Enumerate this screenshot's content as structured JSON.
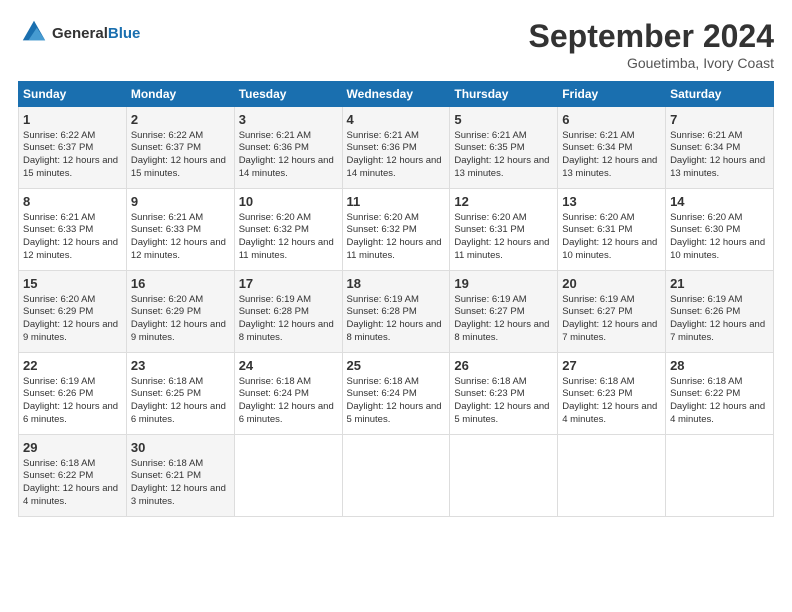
{
  "logo": {
    "text_general": "General",
    "text_blue": "Blue"
  },
  "header": {
    "month": "September 2024",
    "location": "Gouetimba, Ivory Coast"
  },
  "days_of_week": [
    "Sunday",
    "Monday",
    "Tuesday",
    "Wednesday",
    "Thursday",
    "Friday",
    "Saturday"
  ],
  "weeks": [
    [
      {
        "day": "1",
        "sunrise": "Sunrise: 6:22 AM",
        "sunset": "Sunset: 6:37 PM",
        "daylight": "Daylight: 12 hours and 15 minutes."
      },
      {
        "day": "2",
        "sunrise": "Sunrise: 6:22 AM",
        "sunset": "Sunset: 6:37 PM",
        "daylight": "Daylight: 12 hours and 15 minutes."
      },
      {
        "day": "3",
        "sunrise": "Sunrise: 6:21 AM",
        "sunset": "Sunset: 6:36 PM",
        "daylight": "Daylight: 12 hours and 14 minutes."
      },
      {
        "day": "4",
        "sunrise": "Sunrise: 6:21 AM",
        "sunset": "Sunset: 6:36 PM",
        "daylight": "Daylight: 12 hours and 14 minutes."
      },
      {
        "day": "5",
        "sunrise": "Sunrise: 6:21 AM",
        "sunset": "Sunset: 6:35 PM",
        "daylight": "Daylight: 12 hours and 13 minutes."
      },
      {
        "day": "6",
        "sunrise": "Sunrise: 6:21 AM",
        "sunset": "Sunset: 6:34 PM",
        "daylight": "Daylight: 12 hours and 13 minutes."
      },
      {
        "day": "7",
        "sunrise": "Sunrise: 6:21 AM",
        "sunset": "Sunset: 6:34 PM",
        "daylight": "Daylight: 12 hours and 13 minutes."
      }
    ],
    [
      {
        "day": "8",
        "sunrise": "Sunrise: 6:21 AM",
        "sunset": "Sunset: 6:33 PM",
        "daylight": "Daylight: 12 hours and 12 minutes."
      },
      {
        "day": "9",
        "sunrise": "Sunrise: 6:21 AM",
        "sunset": "Sunset: 6:33 PM",
        "daylight": "Daylight: 12 hours and 12 minutes."
      },
      {
        "day": "10",
        "sunrise": "Sunrise: 6:20 AM",
        "sunset": "Sunset: 6:32 PM",
        "daylight": "Daylight: 12 hours and 11 minutes."
      },
      {
        "day": "11",
        "sunrise": "Sunrise: 6:20 AM",
        "sunset": "Sunset: 6:32 PM",
        "daylight": "Daylight: 12 hours and 11 minutes."
      },
      {
        "day": "12",
        "sunrise": "Sunrise: 6:20 AM",
        "sunset": "Sunset: 6:31 PM",
        "daylight": "Daylight: 12 hours and 11 minutes."
      },
      {
        "day": "13",
        "sunrise": "Sunrise: 6:20 AM",
        "sunset": "Sunset: 6:31 PM",
        "daylight": "Daylight: 12 hours and 10 minutes."
      },
      {
        "day": "14",
        "sunrise": "Sunrise: 6:20 AM",
        "sunset": "Sunset: 6:30 PM",
        "daylight": "Daylight: 12 hours and 10 minutes."
      }
    ],
    [
      {
        "day": "15",
        "sunrise": "Sunrise: 6:20 AM",
        "sunset": "Sunset: 6:29 PM",
        "daylight": "Daylight: 12 hours and 9 minutes."
      },
      {
        "day": "16",
        "sunrise": "Sunrise: 6:20 AM",
        "sunset": "Sunset: 6:29 PM",
        "daylight": "Daylight: 12 hours and 9 minutes."
      },
      {
        "day": "17",
        "sunrise": "Sunrise: 6:19 AM",
        "sunset": "Sunset: 6:28 PM",
        "daylight": "Daylight: 12 hours and 8 minutes."
      },
      {
        "day": "18",
        "sunrise": "Sunrise: 6:19 AM",
        "sunset": "Sunset: 6:28 PM",
        "daylight": "Daylight: 12 hours and 8 minutes."
      },
      {
        "day": "19",
        "sunrise": "Sunrise: 6:19 AM",
        "sunset": "Sunset: 6:27 PM",
        "daylight": "Daylight: 12 hours and 8 minutes."
      },
      {
        "day": "20",
        "sunrise": "Sunrise: 6:19 AM",
        "sunset": "Sunset: 6:27 PM",
        "daylight": "Daylight: 12 hours and 7 minutes."
      },
      {
        "day": "21",
        "sunrise": "Sunrise: 6:19 AM",
        "sunset": "Sunset: 6:26 PM",
        "daylight": "Daylight: 12 hours and 7 minutes."
      }
    ],
    [
      {
        "day": "22",
        "sunrise": "Sunrise: 6:19 AM",
        "sunset": "Sunset: 6:26 PM",
        "daylight": "Daylight: 12 hours and 6 minutes."
      },
      {
        "day": "23",
        "sunrise": "Sunrise: 6:18 AM",
        "sunset": "Sunset: 6:25 PM",
        "daylight": "Daylight: 12 hours and 6 minutes."
      },
      {
        "day": "24",
        "sunrise": "Sunrise: 6:18 AM",
        "sunset": "Sunset: 6:24 PM",
        "daylight": "Daylight: 12 hours and 6 minutes."
      },
      {
        "day": "25",
        "sunrise": "Sunrise: 6:18 AM",
        "sunset": "Sunset: 6:24 PM",
        "daylight": "Daylight: 12 hours and 5 minutes."
      },
      {
        "day": "26",
        "sunrise": "Sunrise: 6:18 AM",
        "sunset": "Sunset: 6:23 PM",
        "daylight": "Daylight: 12 hours and 5 minutes."
      },
      {
        "day": "27",
        "sunrise": "Sunrise: 6:18 AM",
        "sunset": "Sunset: 6:23 PM",
        "daylight": "Daylight: 12 hours and 4 minutes."
      },
      {
        "day": "28",
        "sunrise": "Sunrise: 6:18 AM",
        "sunset": "Sunset: 6:22 PM",
        "daylight": "Daylight: 12 hours and 4 minutes."
      }
    ],
    [
      {
        "day": "29",
        "sunrise": "Sunrise: 6:18 AM",
        "sunset": "Sunset: 6:22 PM",
        "daylight": "Daylight: 12 hours and 4 minutes."
      },
      {
        "day": "30",
        "sunrise": "Sunrise: 6:18 AM",
        "sunset": "Sunset: 6:21 PM",
        "daylight": "Daylight: 12 hours and 3 minutes."
      },
      null,
      null,
      null,
      null,
      null
    ]
  ]
}
